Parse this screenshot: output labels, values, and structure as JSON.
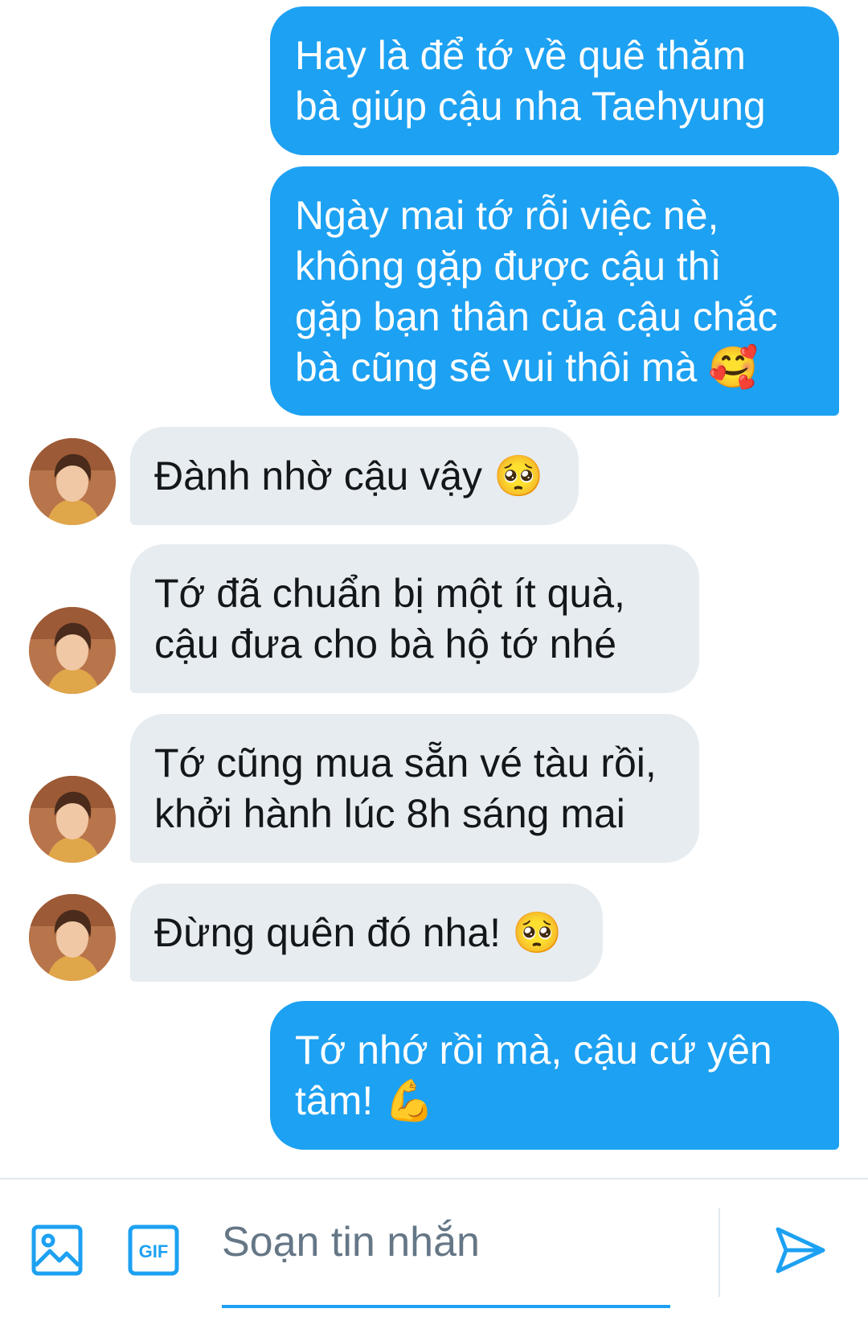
{
  "messages": [
    {
      "direction": "out",
      "lines": [
        "Hay là để tớ về quê thăm",
        "bà giúp cậu nha Taehyung"
      ],
      "emoji": ""
    },
    {
      "direction": "out",
      "lines": [
        "Ngày mai tớ rỗi việc nè,",
        "không gặp được cậu thì",
        "gặp bạn thân của cậu chắc",
        "bà cũng sẽ vui thôi mà"
      ],
      "emoji": "🥰"
    },
    {
      "direction": "in",
      "lines": [
        "Đành nhờ cậu vậy"
      ],
      "emoji": "🥺"
    },
    {
      "direction": "in",
      "lines": [
        "Tớ đã chuẩn bị một ít quà,",
        "cậu đưa cho bà hộ tớ nhé"
      ],
      "emoji": ""
    },
    {
      "direction": "in",
      "lines": [
        "Tớ cũng mua sẵn vé tàu rồi,",
        "khởi hành lúc 8h sáng mai"
      ],
      "emoji": ""
    },
    {
      "direction": "in",
      "lines": [
        "Đừng quên đó nha!"
      ],
      "emoji": "🥺"
    },
    {
      "direction": "out",
      "lines": [
        "Tớ nhớ rồi mà, cậu cứ yên",
        "tâm!"
      ],
      "emoji": "💪"
    }
  ],
  "composer": {
    "placeholder": "Soạn tin nhắn",
    "value": "",
    "gif_label": "GIF",
    "icons": [
      "image-icon",
      "gif-icon",
      "send-icon"
    ]
  },
  "colors": {
    "outgoing_bubble": "#1da1f2",
    "incoming_bubble": "#e6ecf0",
    "accent": "#1da1f2",
    "placeholder": "#657786"
  }
}
